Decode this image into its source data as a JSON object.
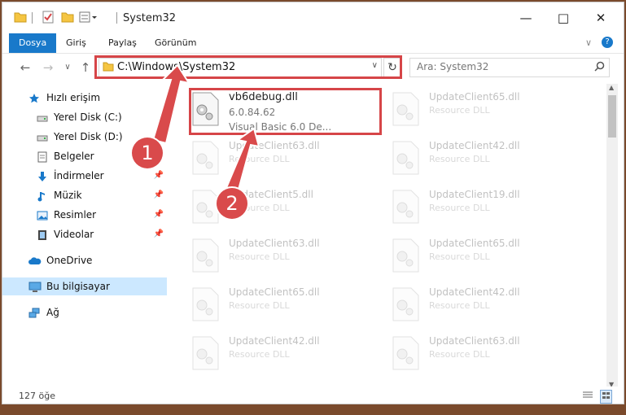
{
  "window": {
    "title": "System32"
  },
  "ribbon": {
    "tabs": [
      "Dosya",
      "Giriş",
      "Paylaş",
      "Görünüm"
    ]
  },
  "address": {
    "path": "C:\\Windows\\System32"
  },
  "search": {
    "placeholder": "Ara: System32"
  },
  "sidebar": {
    "items": [
      {
        "label": "Hızlı erişim",
        "icon": "star-icon"
      },
      {
        "label": "Yerel Disk (C:)",
        "icon": "drive-icon"
      },
      {
        "label": "Yerel Disk (D:)",
        "icon": "drive-icon"
      },
      {
        "label": "Belgeler",
        "icon": "documents-icon"
      },
      {
        "label": "İndirmeler",
        "icon": "download-icon"
      },
      {
        "label": "Müzik",
        "icon": "music-icon"
      },
      {
        "label": "Resimler",
        "icon": "pictures-icon"
      },
      {
        "label": "Videolar",
        "icon": "video-icon"
      },
      {
        "label": "OneDrive",
        "icon": "cloud-icon"
      },
      {
        "label": "Bu bilgisayar",
        "icon": "computer-icon"
      },
      {
        "label": "Ağ",
        "icon": "network-icon"
      }
    ]
  },
  "main_file": {
    "name": "vb6debug.dll",
    "version": "6.0.84.62",
    "description": "Visual Basic 6.0 De..."
  },
  "files": [
    {
      "name": "UpdateClient65.dll",
      "desc": "Resource DLL"
    },
    {
      "name": "UpdateClient63.dll",
      "desc": "Resource DLL"
    },
    {
      "name": "UpdateClient42.dll",
      "desc": "Resource DLL"
    },
    {
      "name": "UpdateClient5.dll",
      "desc": "Resource DLL"
    },
    {
      "name": "UpdateClient19.dll",
      "desc": "Resource DLL"
    },
    {
      "name": "UpdateClient63.dll",
      "desc": "Resource DLL"
    },
    {
      "name": "UpdateClient65.dll",
      "desc": "Resource DLL"
    },
    {
      "name": "UpdateClient65.dll",
      "desc": "Resource DLL"
    },
    {
      "name": "UpdateClient42.dll",
      "desc": "Resource DLL"
    },
    {
      "name": "UpdateClient42.dll",
      "desc": "Resource DLL"
    },
    {
      "name": "UpdateClient63.dll",
      "desc": "Resource DLL"
    }
  ],
  "status": {
    "count": "127 öğe"
  },
  "callouts": [
    "1",
    "2"
  ],
  "colors": {
    "accent": "#1979ca",
    "highlight": "#d64548",
    "selected": "#cce8ff"
  }
}
